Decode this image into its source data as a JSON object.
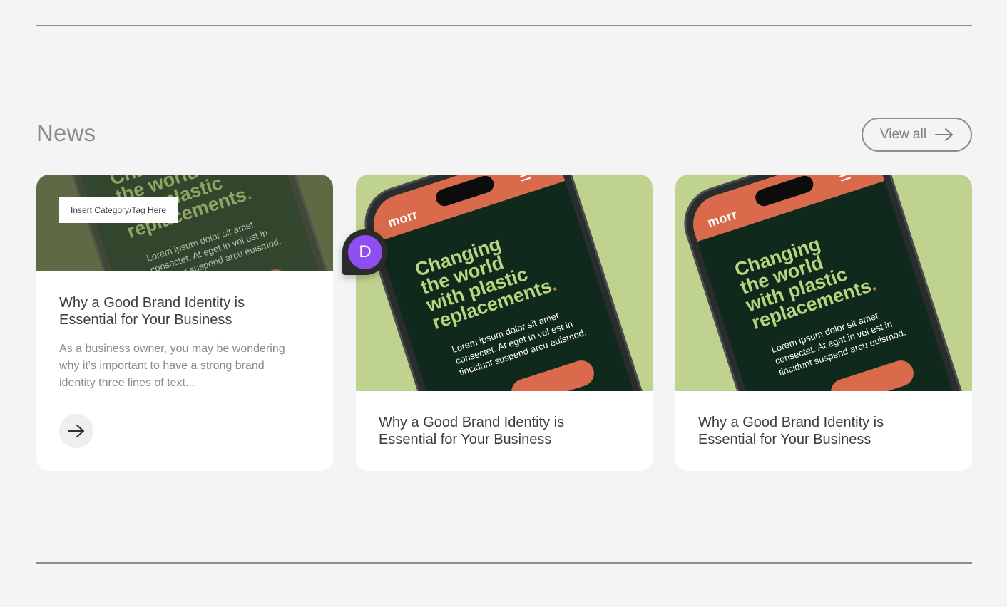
{
  "section": {
    "title": "News",
    "view_all_label": "View all"
  },
  "phone_mockup": {
    "brand": "morr",
    "headline": [
      "Changing",
      "the world",
      "with plastic",
      "replacements"
    ],
    "headline_dot": ".",
    "body": "Lorem ipsum dolor sit amet consectet. At eget in vel est in tincidunt suspend arcu euismod."
  },
  "cards": [
    {
      "tag": "Insert Category/Tag Here",
      "title": "Why a Good Brand Identity is Essential for Your Business",
      "excerpt": "As a business owner, you may be wondering why it's important to have a strong brand identity three lines of text..."
    },
    {
      "title": "Why a Good Brand Identity is Essential for Your Business"
    },
    {
      "title": "Why a Good Brand Identity is Essential for Your Business"
    }
  ],
  "avatar": {
    "initial": "D"
  },
  "colors": {
    "background": "#f4f4f4",
    "accent_green": "#bfd38e",
    "phone_screen": "#0f2a1c",
    "brand_orange": "#d96a4c",
    "avatar_purple": "#8e4ef2"
  },
  "icons": {
    "view_all": "arrow-right-icon",
    "card_cta": "arrow-right-icon"
  }
}
